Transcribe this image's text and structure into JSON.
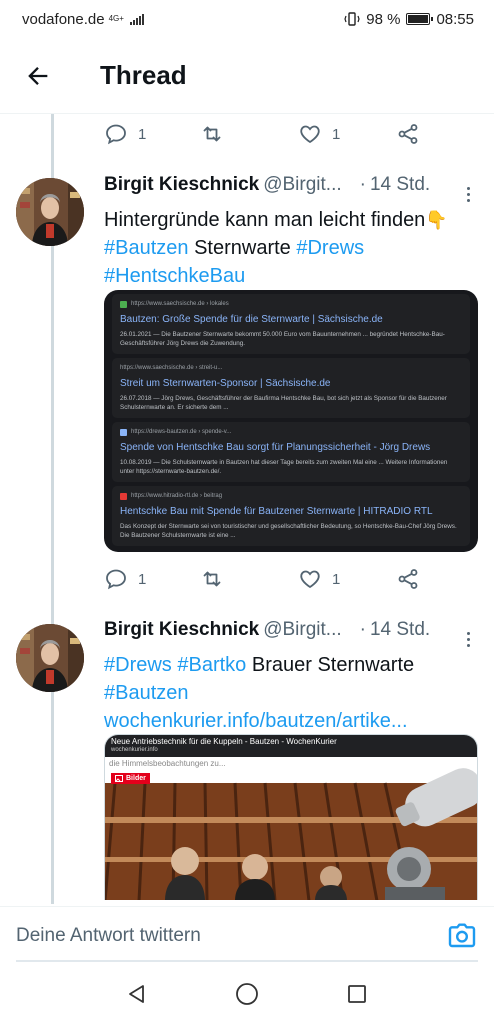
{
  "status_bar": {
    "carrier": "vodafone.de",
    "network": "4G+",
    "battery_percent": "98 %",
    "time": "08:55",
    "battery_level": 0.98
  },
  "header": {
    "title": "Thread",
    "back_icon": "arrow-left-icon"
  },
  "prev_actions": {
    "reply_count": "1",
    "like_count": "1"
  },
  "tweets": [
    {
      "name": "Birgit Kieschnick",
      "handle": "@Birgit...",
      "dot": "·",
      "time": "14 Std.",
      "text_plain_1": "Hintergründe kann man leicht finden",
      "emoji": "👇",
      "hashtag_1": "#Bautzen",
      "text_plain_2": " Sternwarte ",
      "hashtag_2": "#Drews",
      "hashtag_3": "#HentschkeBau",
      "reply_count": "1",
      "like_count": "1",
      "search_results": [
        {
          "url": "https://www.saechsische.de › lokales",
          "title": "Bautzen: Große Spende für die Sternwarte | Sächsische.de",
          "snippet": "26.01.2021 — Die Bautzener Sternwarte bekommt 50.000 Euro vom Bauunternehmen ... begründet Hentschke-Bau-Geschäftsführer Jörg Drews die Zuwendung.",
          "fav_color": "#4caf50"
        },
        {
          "url": "https://www.saechsische.de › streit-u...",
          "title": "Streit um Sternwarten-Sponsor | Sächsische.de",
          "snippet": "26.07.2018 — Jörg Drews, Geschäftsführer der Baufirma Hentschke Bau, bot sich jetzt als Sponsor für die Bautzener Schulsternwarte an. Er sicherte dem ...",
          "fav_color": ""
        },
        {
          "url": "https://drews-bautzen.de › spende-v...",
          "title": "Spende von Hentschke Bau sorgt für Planungssicherheit - Jörg Drews",
          "snippet": "10.08.2019 — Die Schulsternwarte in Bautzen hat dieser Tage bereits zum zweiten Mal eine ... Weitere Informationen unter https://sternwarte-bautzen.de/.",
          "fav_color": "#8ab4f8"
        },
        {
          "url": "https://www.hitradio-rtl.de › beitrag",
          "title": "Hentschke Bau mit Spende für Bautzener Sternwarte | HITRADIO RTL",
          "snippet": "Das Konzept der Sternwarte sei von touristischer und gesellschaftlicher Bedeutung, so Hentschke-Bau-Chef Jörg Drews. Die Bautzener Schulsternwarte ist eine ...",
          "fav_color": "#e53935"
        }
      ]
    },
    {
      "name": "Birgit Kieschnick",
      "handle": "@Birgit...",
      "dot": "·",
      "time": "14 Std.",
      "hashtag_1": "#Drews",
      "hashtag_2": "#Bartko",
      "text_plain": " Brauer Sternwarte",
      "hashtag_3": "#Bautzen",
      "link": "wochenkurier.info/bautzen/artike...",
      "preview": {
        "title": "Neue Antriebstechnik für die Kuppeln - Bautzen - WochenKurier",
        "domain": "wochenkurier.info",
        "faded": "die Himmelsbeobachtungen zu...",
        "tag": "Bilder"
      }
    }
  ],
  "reply_bar": {
    "placeholder": "Deine Antwort twittern",
    "camera_icon": "camera-icon"
  },
  "nav_bar": {
    "back_icon": "triangle-back-icon",
    "home_icon": "circle-home-icon",
    "recents_icon": "square-recents-icon"
  },
  "colors": {
    "accent": "#1d9bf0",
    "text": "#0f1419",
    "muted": "#536471"
  }
}
